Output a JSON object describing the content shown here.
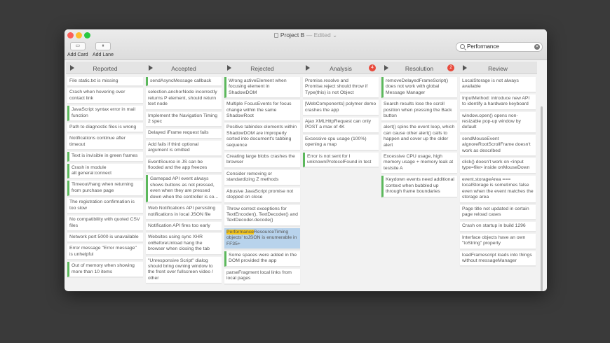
{
  "window": {
    "title": "Project B",
    "status": "— Edited",
    "chevron": "⌄"
  },
  "toolbar": {
    "add_card_label": "Add Card",
    "add_card_icon": "▭",
    "add_lane_label": "Add Lane",
    "add_lane_icon": "⏸"
  },
  "search": {
    "value": "Performance",
    "clear_icon": "✕"
  },
  "lanes": [
    {
      "title": "Reported",
      "badge": "",
      "cards": [
        {
          "text": "File static.txt is missing",
          "accent": false
        },
        {
          "text": "Crash when hovering over contact link",
          "accent": false
        },
        {
          "text": "JavaScript syntax error in mail function",
          "accent": true
        },
        {
          "text": "Path to diagnostic files is wrong",
          "accent": false
        },
        {
          "text": "Notifications continue after timeout",
          "accent": false
        },
        {
          "text": "Text is invisible in green frames",
          "accent": true
        },
        {
          "text": "Crash in module all:general:connect",
          "accent": true
        },
        {
          "text": "Timeout/hang when returning from purchase page",
          "accent": true
        },
        {
          "text": "The registration confirmation is too slow",
          "accent": false
        },
        {
          "text": "No compatibility with quoted CSV files",
          "accent": false
        },
        {
          "text": "Network port 5000 is unavailable",
          "accent": false
        },
        {
          "text": "Error message \"Error message\" is unhelpful",
          "accent": false
        },
        {
          "text": "Out of memory when showing more than 10 items",
          "accent": true
        }
      ]
    },
    {
      "title": "Accepted",
      "badge": "",
      "cards": [
        {
          "text": "sendAsyncMessage callback",
          "accent": true
        },
        {
          "text": "selection.anchorNode incorrectly returns P element, should return text node",
          "accent": false
        },
        {
          "text": "Implement the Navigation Timing 2 spec",
          "accent": false
        },
        {
          "text": "Delayed iFrame request fails",
          "accent": false
        },
        {
          "text": "Add fails if third optional argument is omitted",
          "accent": false
        },
        {
          "text": "EventSource in JS can be flooded and the app freezes",
          "accent": false
        },
        {
          "text": "Gamepad API event always shows buttons as not pressed, even when they are pressed down when the controller is co...",
          "accent": true
        },
        {
          "text": "Web Notifications API persisting notifications in local JSON file",
          "accent": false
        },
        {
          "text": "Notification API fires too early",
          "accent": false
        },
        {
          "text": "Websites using sync XHR onBeforeUnload hang the browser when closing the tab",
          "accent": false
        },
        {
          "text": "\"Unresponsive Script\" dialog should bring owning window to the front over fullscreen video / other",
          "accent": false
        }
      ]
    },
    {
      "title": "Rejected",
      "badge": "",
      "cards": [
        {
          "text": "Wrong activeElement when focusing element in ShadowDOM",
          "accent": true
        },
        {
          "text": "Multiple FocusEvents for focus change within the same ShadowRoot",
          "accent": false
        },
        {
          "text": "Positive tabindex elements within ShadowDOM are improperly sorted into document's tabbing sequence",
          "accent": false
        },
        {
          "text": "Creating large blobs crashes the browser",
          "accent": false
        },
        {
          "text": "Consider removing or standardizing Z methods",
          "accent": false
        },
        {
          "text": "Abusive JavaScript promise not stopped on close",
          "accent": false
        },
        {
          "text": "Throw correct exceptions for TextEncoder(), TextDecoder() and TextDecoder.decode()",
          "accent": false
        },
        {
          "text": "PerformanceResourceTiming objects' toJSON is enumerable in FF35+",
          "accent": false,
          "selected": true,
          "highlight": "Performance"
        },
        {
          "text": "Some spaces were added in the DOM provided the app",
          "accent": true
        },
        {
          "text": "parseFragment local links from local pages",
          "accent": false
        }
      ]
    },
    {
      "title": "Analysis",
      "badge": "4",
      "cards": [
        {
          "text": "Promise.resolve and Promise.reject should throw if Type(this) is not Object",
          "accent": false
        },
        {
          "text": "[WebComponents] polymer demo crashes the app",
          "accent": false
        },
        {
          "text": "Ajax XMLHttpRequest can only POST a max of 4K",
          "accent": false
        },
        {
          "text": "Excessive cpu usage (100%) opening a map",
          "accent": false
        },
        {
          "text": "Error is not sent for I unknownProtocolFound in test",
          "accent": true
        }
      ]
    },
    {
      "title": "Resolution",
      "badge": "2",
      "cards": [
        {
          "text": "removeDelayedFrameScript() does not work with global Message Manager",
          "accent": true
        },
        {
          "text": "Search results lose the scroll position when pressing the Back button",
          "accent": false
        },
        {
          "text": "alert() spins the event loop, which can cause other alert() calls to happen and cover up the older alert",
          "accent": false
        },
        {
          "text": "Excessive CPU usage, high memory usage + memory leak at testsite A",
          "accent": false
        },
        {
          "text": "Keydown events need additional context when bubbled up through frame boundaries",
          "accent": true
        }
      ]
    },
    {
      "title": "Review",
      "badge": "",
      "cards": [
        {
          "text": "LocalStorage is not always available",
          "accent": false
        },
        {
          "text": "InputMethod: introduce new API to identify a hardware keyboard",
          "accent": false
        },
        {
          "text": "window.open() opens non-resizable pop-up window by default",
          "accent": false
        },
        {
          "text": "sendMouseEvent aIgnoreRootScrollFrame doesn't work as described",
          "accent": false
        },
        {
          "text": "click() doesn't work on <input type=file> inside onMouseDown",
          "accent": false
        },
        {
          "text": "event.storageArea === localStorage is sometimes false even when the event matches the storage area",
          "accent": false
        },
        {
          "text": "Page title not updated in certain page reload cases",
          "accent": false
        },
        {
          "text": "Crash on startup in build 1296",
          "accent": false
        },
        {
          "text": "Interface objects have an own \"toString\" property",
          "accent": false
        },
        {
          "text": "loadFramescript loads into things without messageManager",
          "accent": false
        }
      ]
    }
  ]
}
